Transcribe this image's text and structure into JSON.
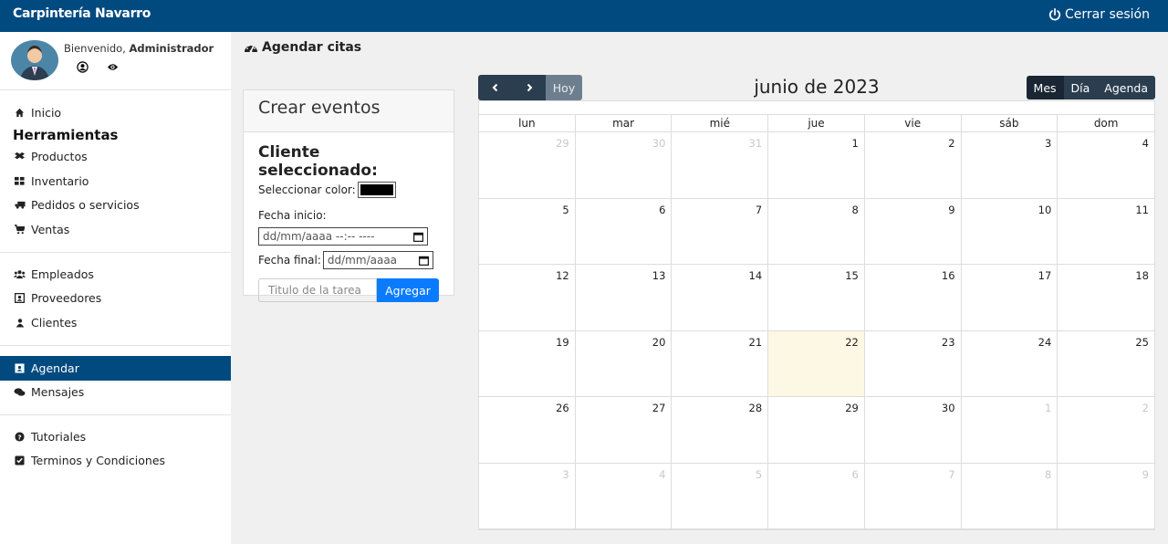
{
  "app": {
    "brand": "Carpintería Navarro",
    "logout_label": "Cerrar sesión"
  },
  "profile": {
    "welcome_prefix": "Bienvenido,",
    "user_name": "Administrador"
  },
  "sidebar": {
    "home": "Inicio",
    "tools_title": "Herramientas",
    "tools": [
      {
        "label": "Productos",
        "icon": "boxes-icon"
      },
      {
        "label": "Inventario",
        "icon": "grid-icon"
      },
      {
        "label": "Pedidos o servicios",
        "icon": "truck-icon"
      },
      {
        "label": "Ventas",
        "icon": "cart-icon"
      }
    ],
    "people": [
      {
        "label": "Empleados",
        "icon": "users-icon"
      },
      {
        "label": "Proveedores",
        "icon": "contact-card-icon"
      },
      {
        "label": "Clientes",
        "icon": "user-icon"
      }
    ],
    "comms": [
      {
        "label": "Agendar",
        "icon": "calendar-icon",
        "active": true
      },
      {
        "label": "Mensajes",
        "icon": "chat-icon"
      }
    ],
    "help": [
      {
        "label": "Tutoriales",
        "icon": "question-icon"
      },
      {
        "label": "Terminos y Condiciones",
        "icon": "check-square-icon"
      }
    ]
  },
  "page": {
    "title": "Agendar citas"
  },
  "event_form": {
    "header": "Crear eventos",
    "client_title": "Cliente seleccionado:",
    "color_label": "Seleccionar color:",
    "color_value": "#000000",
    "start_label": "Fecha inicio:",
    "start_placeholder": "dd/mm/aaaa --:-- ----",
    "end_label": "Fecha final:",
    "end_placeholder": "dd/mm/aaaa",
    "task_placeholder": "Titulo de la tarea",
    "add_label": "Agregar"
  },
  "calendar": {
    "title": "junio de 2023",
    "prev_icon": "chevron-left-icon",
    "next_icon": "chevron-right-icon",
    "today_label": "Hoy",
    "views": [
      "Mes",
      "Día",
      "Agenda"
    ],
    "active_view": "Mes",
    "days_of_week": [
      "lun",
      "mar",
      "mié",
      "jue",
      "vie",
      "sáb",
      "dom"
    ],
    "today": 22,
    "cells": [
      {
        "d": "29",
        "o": true
      },
      {
        "d": "30",
        "o": true
      },
      {
        "d": "31",
        "o": true
      },
      {
        "d": "1"
      },
      {
        "d": "2"
      },
      {
        "d": "3"
      },
      {
        "d": "4"
      },
      {
        "d": "5"
      },
      {
        "d": "6"
      },
      {
        "d": "7"
      },
      {
        "d": "8"
      },
      {
        "d": "9"
      },
      {
        "d": "10"
      },
      {
        "d": "11"
      },
      {
        "d": "12"
      },
      {
        "d": "13"
      },
      {
        "d": "14"
      },
      {
        "d": "15"
      },
      {
        "d": "16"
      },
      {
        "d": "17"
      },
      {
        "d": "18"
      },
      {
        "d": "19"
      },
      {
        "d": "20"
      },
      {
        "d": "21"
      },
      {
        "d": "22",
        "t": true
      },
      {
        "d": "23"
      },
      {
        "d": "24"
      },
      {
        "d": "25"
      },
      {
        "d": "26"
      },
      {
        "d": "27"
      },
      {
        "d": "28"
      },
      {
        "d": "29"
      },
      {
        "d": "30"
      },
      {
        "d": "1",
        "o": true
      },
      {
        "d": "2",
        "o": true
      },
      {
        "d": "3",
        "o": true
      },
      {
        "d": "4",
        "o": true
      },
      {
        "d": "5",
        "o": true
      },
      {
        "d": "6",
        "o": true
      },
      {
        "d": "7",
        "o": true
      },
      {
        "d": "8",
        "o": true
      },
      {
        "d": "9",
        "o": true
      }
    ]
  }
}
